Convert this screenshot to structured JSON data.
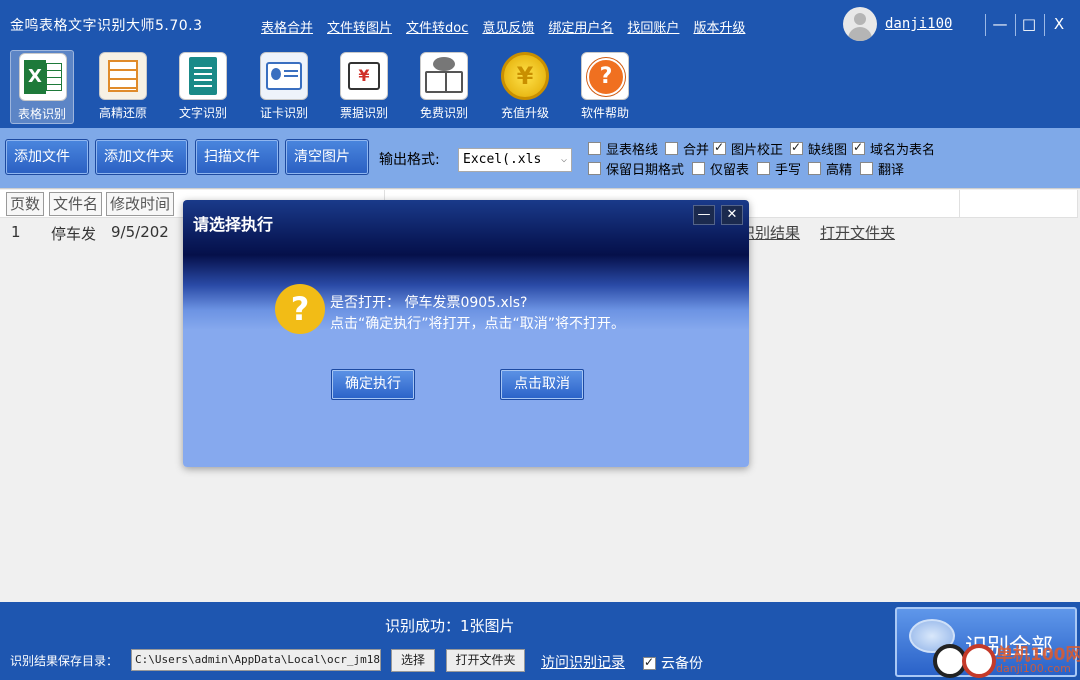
{
  "window": {
    "title": "金鸣表格文字识别大师5.70.3",
    "menus": [
      "表格合并",
      "文件转图片",
      "文件转doc",
      "意见反馈",
      "绑定用户名",
      "找回账户",
      "版本升级"
    ],
    "username": "danji100",
    "controls": {
      "minimize": "—",
      "maximize": "□",
      "close": "X"
    }
  },
  "toolbar": {
    "tools": [
      {
        "label": "表格识别",
        "icon": "excel-icon",
        "active": true
      },
      {
        "label": "高精还原",
        "icon": "layout-icon"
      },
      {
        "label": "文字识别",
        "icon": "document-icon"
      },
      {
        "label": "证卡识别",
        "icon": "id-card-icon"
      },
      {
        "label": "票据识别",
        "icon": "receipt-icon"
      },
      {
        "label": "免费识别",
        "icon": "book-icon"
      },
      {
        "label": "充值升级",
        "icon": "coin-icon"
      },
      {
        "label": "软件帮助",
        "icon": "help-icon"
      }
    ]
  },
  "actions": {
    "add_file": "添加文件",
    "add_folder": "添加文件夹",
    "scan_file": "扫描文件",
    "clear_images": "清空图片",
    "output_format_label": "输出格式:",
    "output_format_value": "Excel(.xls",
    "options": [
      {
        "label": "显表格线",
        "checked": false
      },
      {
        "label": "合并",
        "checked": false
      },
      {
        "label": "图片校正",
        "checked": true
      },
      {
        "label": "缺线图",
        "checked": true
      },
      {
        "label": "域名为表名",
        "checked": true
      },
      {
        "label": "保留日期格式",
        "checked": false
      },
      {
        "label": "仅留表",
        "checked": false
      },
      {
        "label": "手写",
        "checked": false
      },
      {
        "label": "高精",
        "checked": false
      },
      {
        "label": "翻译",
        "checked": false
      }
    ]
  },
  "table": {
    "columns": [
      "页数",
      "文件名",
      "修改时间"
    ],
    "rows": [
      {
        "page": "1",
        "filename": "停车发",
        "modified": "9/5/202",
        "result_link": "识别结果",
        "folder_link": "打开文件夹"
      }
    ]
  },
  "dialog": {
    "title": "请选择执行",
    "icon": "question-icon",
    "line1": "是否打开：  停车发票0905.xls?",
    "line2": "点击“确定执行”将打开，点击“取消”将不打开。",
    "confirm": "确定执行",
    "cancel": "点击取消",
    "minimize": "—",
    "close": "✕"
  },
  "footer": {
    "status": "识别成功：1张图片",
    "save_dir_label": "识别结果保存目录：",
    "save_dir_value": "C:\\Users\\admin\\AppData\\Local\\ocr_jm18",
    "select_button": "选择",
    "open_folder_button": "打开文件夹",
    "history_link": "访问识别记录",
    "cloud_backup": {
      "label": "云备份",
      "checked": true
    },
    "recognize_all": "识别全部"
  },
  "watermark": {
    "text": "单机100网",
    "sub": "danji100.com"
  }
}
